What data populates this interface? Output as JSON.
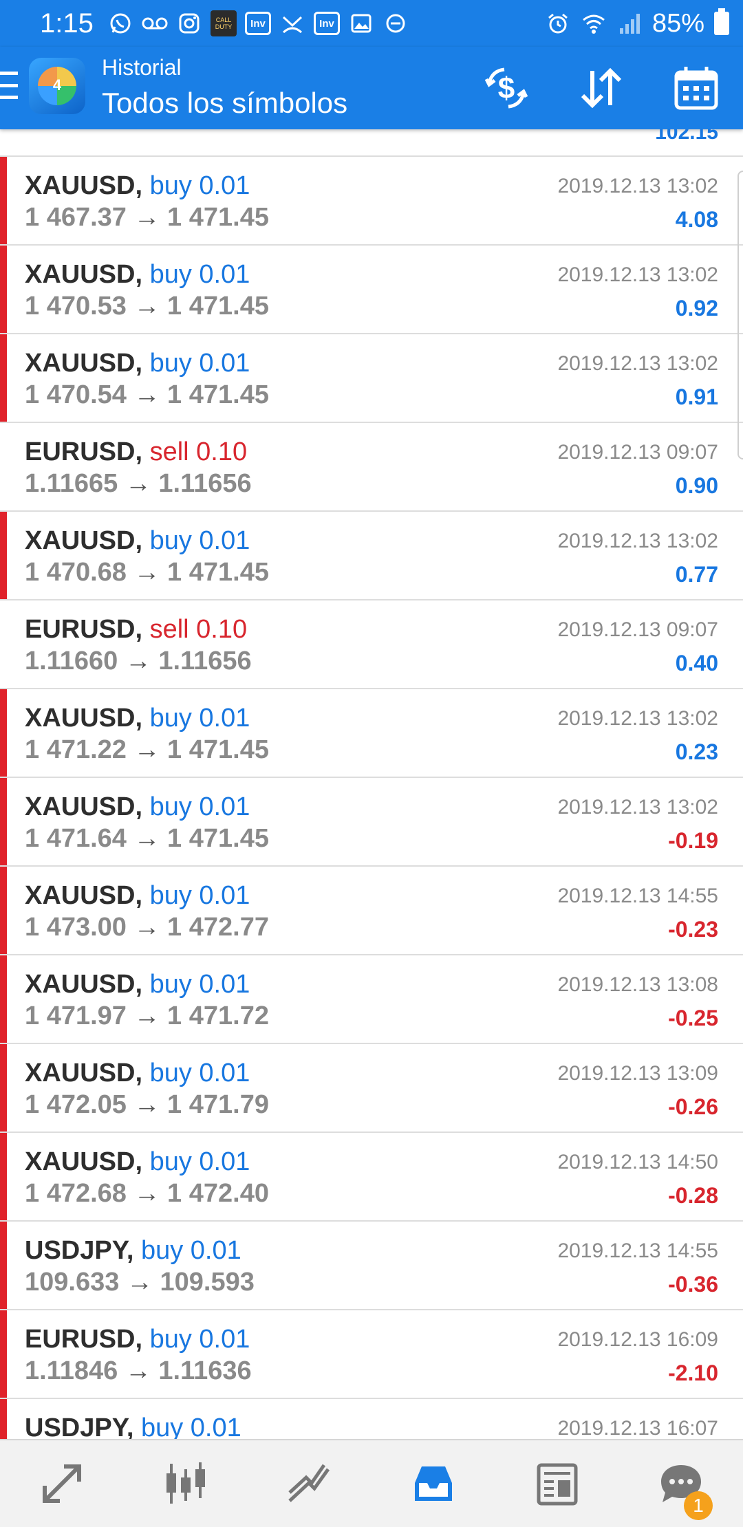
{
  "status_bar": {
    "time": "1:15",
    "battery": "85%",
    "left_icons": [
      "whatsapp-icon",
      "voicemail-icon",
      "instagram-icon",
      "call-of-duty-icon",
      "investing-icon",
      "missed-call-icon",
      "investing-icon",
      "gallery-icon",
      "do-not-disturb-icon"
    ],
    "right_icons": [
      "alarm-icon",
      "wifi-icon",
      "signal-icon",
      "battery-icon"
    ],
    "game_icon_text": "CALL DUTY",
    "inv_text": "Inv"
  },
  "app_bar": {
    "subtitle": "Historial",
    "title": "Todos los símbolos",
    "actions": [
      "currency-exchange-icon",
      "sort-icon",
      "calendar-icon"
    ]
  },
  "list": {
    "partial_top_profit": "102.15",
    "trades": [
      {
        "symbol": "XAUUSD,",
        "type": "buy",
        "volume": "buy 0.01",
        "open": "1 467.37",
        "close": "1 471.45",
        "arrow": "→",
        "date": "2019.12.13 13:02",
        "profit": "4.08",
        "profit_sign": "pos",
        "marked": true
      },
      {
        "symbol": "XAUUSD,",
        "type": "buy",
        "volume": "buy 0.01",
        "open": "1 470.53",
        "close": "1 471.45",
        "arrow": "→",
        "date": "2019.12.13 13:02",
        "profit": "0.92",
        "profit_sign": "pos",
        "marked": true
      },
      {
        "symbol": "XAUUSD,",
        "type": "buy",
        "volume": "buy 0.01",
        "open": "1 470.54",
        "close": "1 471.45",
        "arrow": "→",
        "date": "2019.12.13 13:02",
        "profit": "0.91",
        "profit_sign": "pos",
        "marked": true
      },
      {
        "symbol": "EURUSD,",
        "type": "sell",
        "volume": "sell 0.10",
        "open": "1.11665",
        "close": "1.11656",
        "arrow": "→",
        "date": "2019.12.13 09:07",
        "profit": "0.90",
        "profit_sign": "pos",
        "marked": false
      },
      {
        "symbol": "XAUUSD,",
        "type": "buy",
        "volume": "buy 0.01",
        "open": "1 470.68",
        "close": "1 471.45",
        "arrow": "→",
        "date": "2019.12.13 13:02",
        "profit": "0.77",
        "profit_sign": "pos",
        "marked": true
      },
      {
        "symbol": "EURUSD,",
        "type": "sell",
        "volume": "sell 0.10",
        "open": "1.11660",
        "close": "1.11656",
        "arrow": "→",
        "date": "2019.12.13 09:07",
        "profit": "0.40",
        "profit_sign": "pos",
        "marked": false
      },
      {
        "symbol": "XAUUSD,",
        "type": "buy",
        "volume": "buy 0.01",
        "open": "1 471.22",
        "close": "1 471.45",
        "arrow": "→",
        "date": "2019.12.13 13:02",
        "profit": "0.23",
        "profit_sign": "pos",
        "marked": true
      },
      {
        "symbol": "XAUUSD,",
        "type": "buy",
        "volume": "buy 0.01",
        "open": "1 471.64",
        "close": "1 471.45",
        "arrow": "→",
        "date": "2019.12.13 13:02",
        "profit": "-0.19",
        "profit_sign": "neg",
        "marked": true
      },
      {
        "symbol": "XAUUSD,",
        "type": "buy",
        "volume": "buy 0.01",
        "open": "1 473.00",
        "close": "1 472.77",
        "arrow": "→",
        "date": "2019.12.13 14:55",
        "profit": "-0.23",
        "profit_sign": "neg",
        "marked": true
      },
      {
        "symbol": "XAUUSD,",
        "type": "buy",
        "volume": "buy 0.01",
        "open": "1 471.97",
        "close": "1 471.72",
        "arrow": "→",
        "date": "2019.12.13 13:08",
        "profit": "-0.25",
        "profit_sign": "neg",
        "marked": true
      },
      {
        "symbol": "XAUUSD,",
        "type": "buy",
        "volume": "buy 0.01",
        "open": "1 472.05",
        "close": "1 471.79",
        "arrow": "→",
        "date": "2019.12.13 13:09",
        "profit": "-0.26",
        "profit_sign": "neg",
        "marked": true
      },
      {
        "symbol": "XAUUSD,",
        "type": "buy",
        "volume": "buy 0.01",
        "open": "1 472.68",
        "close": "1 472.40",
        "arrow": "→",
        "date": "2019.12.13 14:50",
        "profit": "-0.28",
        "profit_sign": "neg",
        "marked": true
      },
      {
        "symbol": "USDJPY,",
        "type": "buy",
        "volume": "buy 0.01",
        "open": "109.633",
        "close": "109.593",
        "arrow": "→",
        "date": "2019.12.13 14:55",
        "profit": "-0.36",
        "profit_sign": "neg",
        "marked": true
      },
      {
        "symbol": "EURUSD,",
        "type": "buy",
        "volume": "buy 0.01",
        "open": "1.11846",
        "close": "1.11636",
        "arrow": "→",
        "date": "2019.12.13 16:09",
        "profit": "-2.10",
        "profit_sign": "neg",
        "marked": true
      },
      {
        "symbol": "USDJPY,",
        "type": "buy",
        "volume": "buy 0.01",
        "open": "",
        "close": "",
        "arrow": "",
        "date": "2019.12.13 16:07",
        "profit": "",
        "profit_sign": "neg",
        "marked": true
      }
    ]
  },
  "bottom_nav": {
    "items": [
      "quotes-icon",
      "chart-icon",
      "trade-icon",
      "history-icon",
      "news-icon",
      "messages-icon"
    ],
    "active": "history-icon",
    "message_badge": "1"
  },
  "colors": {
    "primary": "#1a7fe6",
    "buy": "#1877e0",
    "sell": "#d8262e",
    "row_marker": "#e0222a",
    "badge": "#f5a11c"
  }
}
